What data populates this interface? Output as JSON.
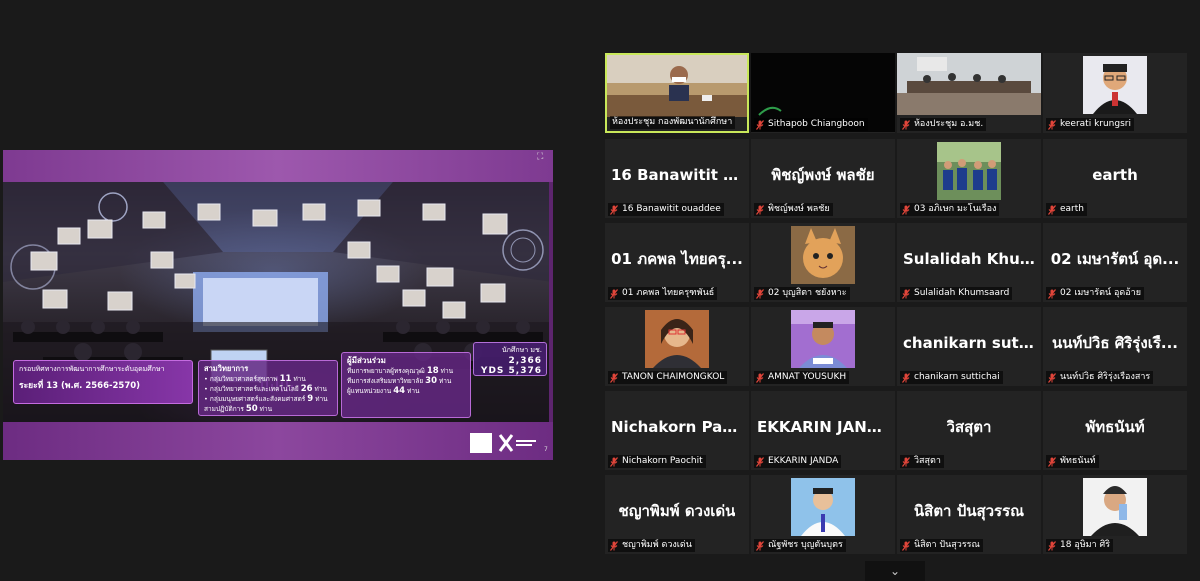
{
  "shared_screen": {
    "stats_left": {
      "line1": "กรอบทิศทางการพัฒนาการศึกษาระดับอุดมศึกษา",
      "line2": "ระยะที่ 13 (พ.ศ. 2566-2570)"
    },
    "stats_mid": {
      "heading": "สามวิทยาการ",
      "rows": [
        {
          "text": "กลุ่มวิทยาศาสตร์สุขภาพ",
          "value": "11",
          "unit": "ท่าน"
        },
        {
          "text": "กลุ่มวิทยาศาสตร์และเทคโนโลยี",
          "value": "26",
          "unit": "ท่าน"
        },
        {
          "text": "กลุ่มมนุษยศาสตร์และสังคมศาสตร์",
          "value": "9",
          "unit": "ท่าน"
        }
      ],
      "footer_text": "สามปฏิบัติการ",
      "footer_value": "50",
      "footer_unit": "ท่าน"
    },
    "stats_right": {
      "heading": "ผู้มีส่วนร่วม",
      "rows": [
        {
          "text": "ทีมการพยาบาลผู้ทรงคุณวุฒิ",
          "value": "18",
          "unit": "ท่าน"
        },
        {
          "text": "ทีมการส่งเสริมมหาวิทยาลัย",
          "value": "30",
          "unit": "ท่าน"
        },
        {
          "text": "ผู้แทนหน่วยงาน",
          "value": "44",
          "unit": "ท่าน"
        }
      ]
    },
    "visitor": {
      "label": "นักศึกษา มช.",
      "line1": "2,366",
      "line2": "YDS 5,376"
    },
    "slide_number": "7"
  },
  "participants": [
    {
      "label": "ห้องประชุม กองพัฒนานักศึกษา",
      "display": "",
      "muted": false,
      "active": true,
      "photo": "meeting-room"
    },
    {
      "label": "Sithapob Chiangboon",
      "display": "",
      "muted": true,
      "active": false,
      "photo": "dark"
    },
    {
      "label": "ห้องประชุม อ.มช.",
      "display": "",
      "muted": true,
      "active": false,
      "photo": "conference"
    },
    {
      "label": "keerati krungsri",
      "display": "",
      "muted": true,
      "active": false,
      "photo": "portrait-glasses"
    },
    {
      "label": "16 Banawitit ouaddee",
      "display": "16 Banawitit ou...",
      "muted": true,
      "active": false,
      "photo": ""
    },
    {
      "label": "พิชญ์พงษ์ พลชัย",
      "display": "พิชญ์พงษ์ พลชัย",
      "muted": true,
      "active": false,
      "photo": ""
    },
    {
      "label": "03 อภิเษก มะโนเรือง",
      "display": "",
      "muted": true,
      "active": false,
      "photo": "group-outdoor"
    },
    {
      "label": "earth",
      "display": "earth",
      "muted": true,
      "active": false,
      "photo": ""
    },
    {
      "label": "01 ภคพล ไทยครุฑพันธ์",
      "display": "01 ภคพล ไทยครุ...",
      "muted": true,
      "active": false,
      "photo": ""
    },
    {
      "label": "02 บุญสิตา ชยังหาะ",
      "display": "",
      "muted": true,
      "active": false,
      "photo": "cat"
    },
    {
      "label": "Sulalidah Khumsaard",
      "display": "Sulalidah Khum...",
      "muted": true,
      "active": false,
      "photo": ""
    },
    {
      "label": "02 เมษารัตน์ อุดอ้าย",
      "display": "02 เมษารัตน์ อุด...",
      "muted": true,
      "active": false,
      "photo": ""
    },
    {
      "label": "TANON CHAIMONGKOL",
      "display": "",
      "muted": true,
      "active": false,
      "photo": "woman-smile"
    },
    {
      "label": "AMNAT YOUSUKH",
      "display": "",
      "muted": true,
      "active": false,
      "photo": "man-purple"
    },
    {
      "label": "chanikarn suttichai",
      "display": "chanikarn suttic...",
      "muted": true,
      "active": false,
      "photo": ""
    },
    {
      "label": "นนท์ปวิธ ศิริรุ่งเรืองสาร",
      "display": "นนท์ปวิธ ศิริรุ่งเรื...",
      "muted": true,
      "active": false,
      "photo": ""
    },
    {
      "label": "Nichakorn Paochit",
      "display": "Nichakorn Paoc...",
      "muted": true,
      "active": false,
      "photo": ""
    },
    {
      "label": "EKKARIN JANDA",
      "display": "EKKARIN JANDA",
      "muted": true,
      "active": false,
      "photo": ""
    },
    {
      "label": "วิสสุตา",
      "display": "วิสสุตา",
      "muted": true,
      "active": false,
      "photo": ""
    },
    {
      "label": "พัทธนันท์",
      "display": "พัทธนันท์",
      "muted": true,
      "active": false,
      "photo": ""
    },
    {
      "label": "ชญาพิมพ์ ดวงเด่น",
      "display": "ชญาพิมพ์ ดวงเด่น",
      "muted": true,
      "active": false,
      "photo": ""
    },
    {
      "label": "ณัฐพัชร บุญตันบุตร",
      "display": "",
      "muted": true,
      "active": false,
      "photo": "student-sky"
    },
    {
      "label": "นิสิตา ปันสุวรรณ",
      "display": "นิสิตา ปันสุวรรณ",
      "muted": true,
      "active": false,
      "photo": ""
    },
    {
      "label": "18 อุษิมา ศิริ",
      "display": "",
      "muted": true,
      "active": false,
      "photo": "man-drinking"
    }
  ],
  "icons": {
    "mute": "mic-off-icon",
    "expand": "expand-icon",
    "scroll": "chevron-down-icon"
  },
  "colors": {
    "active_border": "#c9e85a",
    "mute_red": "#e0453a",
    "share_purple": "#7e3a91"
  }
}
